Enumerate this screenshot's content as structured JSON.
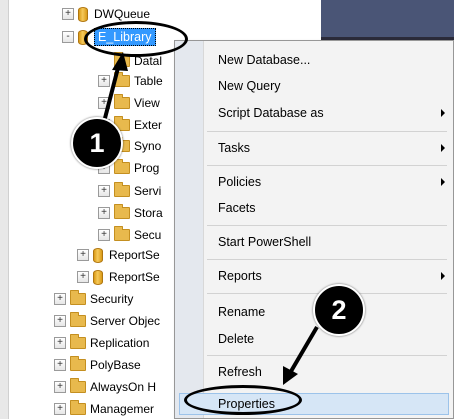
{
  "tree": {
    "items": [
      {
        "label": "DWQueue",
        "icon": "database-icon",
        "expander": "+"
      },
      {
        "label": "E_Library",
        "icon": "database-icon",
        "expander": "-",
        "selected": true
      },
      {
        "label": "Datal",
        "icon": "folder-icon",
        "expander": ""
      },
      {
        "label": "Table",
        "icon": "folder-icon",
        "expander": "+"
      },
      {
        "label": "View",
        "icon": "folder-icon",
        "expander": "+"
      },
      {
        "label": "Exter",
        "icon": "folder-icon",
        "expander": "+"
      },
      {
        "label": "Syno",
        "icon": "folder-icon",
        "expander": "+"
      },
      {
        "label": "Prog",
        "icon": "folder-icon",
        "expander": "+"
      },
      {
        "label": "Servi",
        "icon": "folder-icon",
        "expander": "+"
      },
      {
        "label": "Stora",
        "icon": "folder-icon",
        "expander": "+"
      },
      {
        "label": "Secu",
        "icon": "folder-icon",
        "expander": "+"
      },
      {
        "label": "ReportSe",
        "icon": "database-icon",
        "expander": "+"
      },
      {
        "label": "ReportSe",
        "icon": "database-icon",
        "expander": "+"
      },
      {
        "label": "Security",
        "icon": "folder-icon",
        "expander": "+"
      },
      {
        "label": "Server Objec",
        "icon": "folder-icon",
        "expander": "+"
      },
      {
        "label": "Replication",
        "icon": "folder-icon",
        "expander": "+"
      },
      {
        "label": "PolyBase",
        "icon": "folder-icon",
        "expander": "+"
      },
      {
        "label": "AlwaysOn H",
        "icon": "folder-icon",
        "expander": "+"
      },
      {
        "label": "Managemer",
        "icon": "folder-icon",
        "expander": "+"
      }
    ]
  },
  "context_menu": {
    "items": [
      {
        "label": "New Database...",
        "submenu": false
      },
      {
        "label": "New Query",
        "submenu": false
      },
      {
        "label": "Script Database as",
        "submenu": true
      },
      {
        "label": "Tasks",
        "submenu": true
      },
      {
        "label": "Policies",
        "submenu": true
      },
      {
        "label": "Facets",
        "submenu": false
      },
      {
        "label": "Start PowerShell",
        "submenu": false
      },
      {
        "label": "Reports",
        "submenu": true
      },
      {
        "label": "Rename",
        "submenu": false
      },
      {
        "label": "Delete",
        "submenu": false
      },
      {
        "label": "Refresh",
        "submenu": false
      },
      {
        "label": "Properties",
        "submenu": false,
        "highlighted": true
      }
    ]
  },
  "annotations": {
    "step1": "1",
    "step2": "2"
  },
  "colors": {
    "selection": "#3399ff",
    "menu_highlight": "#d6e6f6",
    "folder": "#e8b94d",
    "dark_panel": "#2b2b3a"
  }
}
